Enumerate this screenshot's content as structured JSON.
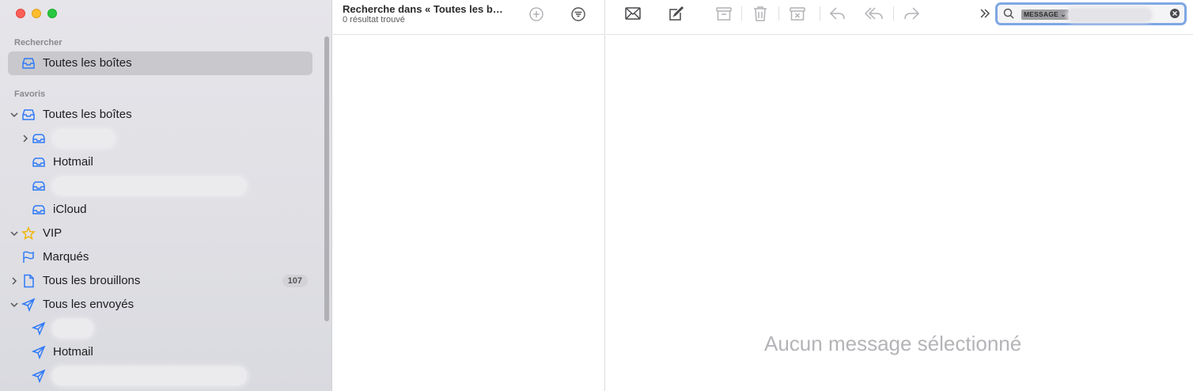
{
  "window": {
    "controls": [
      "close",
      "minimize",
      "zoom"
    ]
  },
  "sidebar": {
    "sections": [
      {
        "title": "Rechercher"
      },
      {
        "title": "Favoris"
      }
    ],
    "search_item": {
      "label": "Toutes les boîtes",
      "icon": "tray-icon"
    },
    "favorites": [
      {
        "label": "Toutes les boîtes",
        "icon": "tray-icon",
        "expanded": true
      },
      {
        "label": "",
        "icon": "tray-icon",
        "redacted": true
      },
      {
        "label": "Hotmail",
        "icon": "tray-icon"
      },
      {
        "label": "",
        "icon": "tray-icon",
        "redacted": true
      },
      {
        "label": "iCloud",
        "icon": "tray-icon"
      },
      {
        "label": "VIP",
        "icon": "star-icon",
        "expanded": true
      },
      {
        "label": "Marqués",
        "icon": "flag-icon"
      },
      {
        "label": "Tous les brouillons",
        "icon": "document-icon",
        "badge": "107"
      },
      {
        "label": "Tous les envoyés",
        "icon": "paper-plane-icon",
        "expanded": true
      },
      {
        "label": "",
        "icon": "paper-plane-icon",
        "redacted": true
      },
      {
        "label": "Hotmail",
        "icon": "paper-plane-icon"
      },
      {
        "label": "",
        "icon": "paper-plane-icon",
        "redacted": true
      }
    ]
  },
  "message_list": {
    "title": "Recherche dans « Toutes les b…",
    "subtitle": "0 résultat trouvé"
  },
  "toolbar": {
    "buttons": [
      "get-mail",
      "compose",
      "archive",
      "trash",
      "junk",
      "reply",
      "reply-all",
      "forward",
      "more"
    ]
  },
  "search": {
    "token": "MESSAGE",
    "value": ""
  },
  "reading_pane": {
    "empty_text": "Aucun message sélectionné"
  },
  "colors": {
    "accent": "#2f7af7",
    "vip_star": "#f0b400",
    "selected_row": "#c9c9cd"
  }
}
